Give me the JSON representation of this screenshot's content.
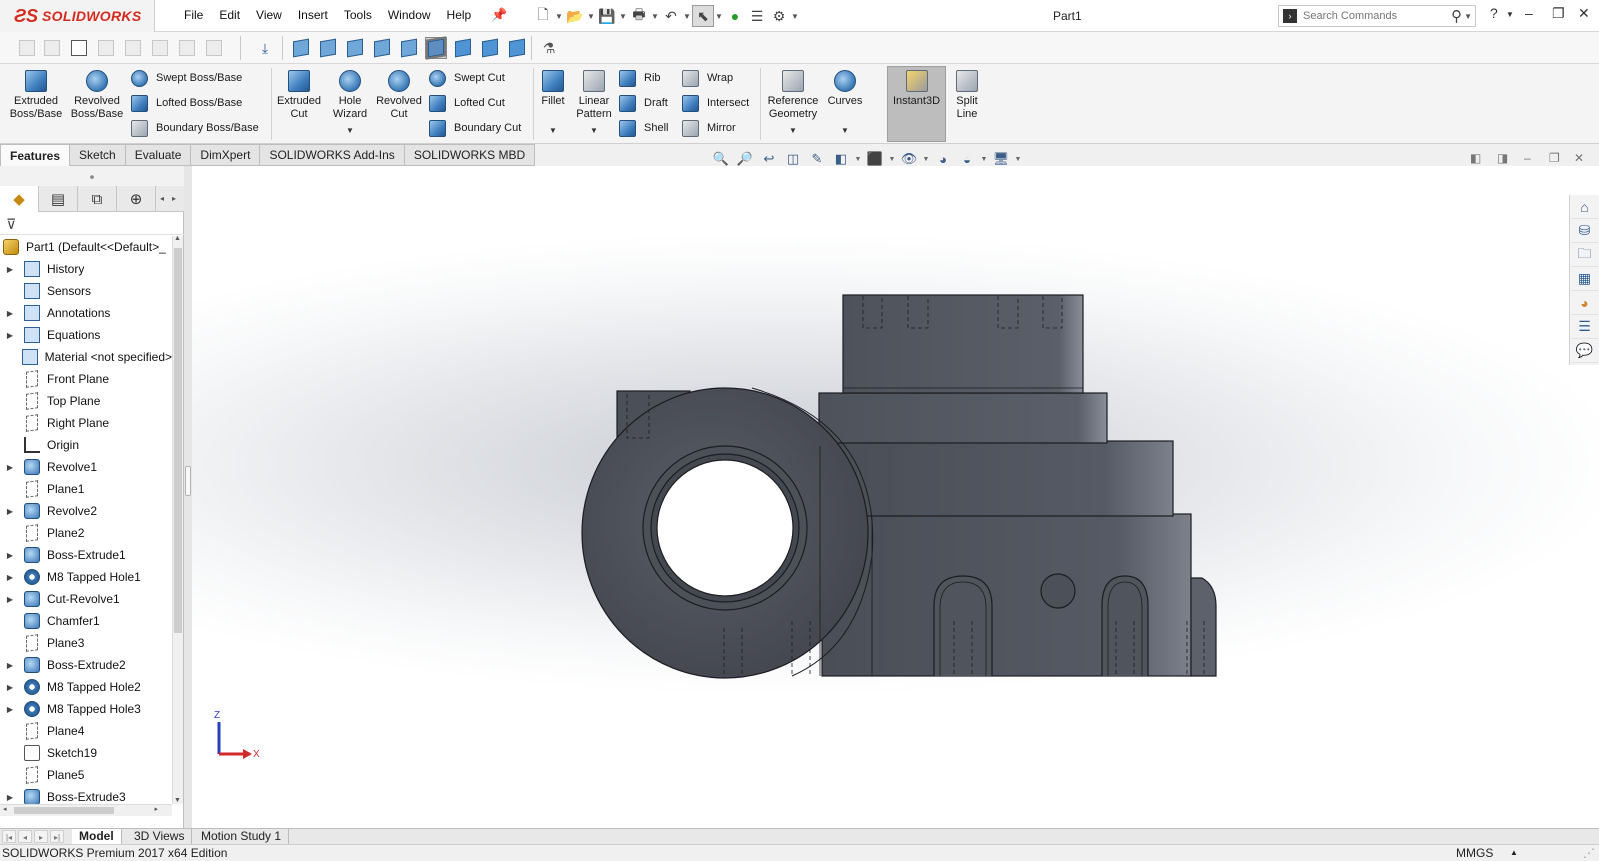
{
  "app": {
    "brand": "SOLIDWORKS",
    "document_title": "Part1"
  },
  "menu": [
    "File",
    "Edit",
    "View",
    "Insert",
    "Tools",
    "Window",
    "Help"
  ],
  "search": {
    "placeholder": "Search Commands"
  },
  "ribbon": {
    "extruded_boss": [
      "Extruded",
      "Boss/Base"
    ],
    "revolved_boss": [
      "Revolved",
      "Boss/Base"
    ],
    "swept_boss": "Swept Boss/Base",
    "lofted_boss": "Lofted Boss/Base",
    "boundary_boss": "Boundary Boss/Base",
    "extruded_cut": [
      "Extruded",
      "Cut"
    ],
    "hole_wizard": [
      "Hole",
      "Wizard"
    ],
    "revolved_cut": [
      "Revolved",
      "Cut"
    ],
    "swept_cut": "Swept Cut",
    "lofted_cut": "Lofted Cut",
    "boundary_cut": "Boundary Cut",
    "fillet": "Fillet",
    "linear_pattern": [
      "Linear",
      "Pattern"
    ],
    "rib": "Rib",
    "draft": "Draft",
    "shell": "Shell",
    "wrap": "Wrap",
    "intersect": "Intersect",
    "mirror": "Mirror",
    "reference_geometry": [
      "Reference",
      "Geometry"
    ],
    "curves": "Curves",
    "instant3d": "Instant3D",
    "split_line": [
      "Split",
      "Line"
    ]
  },
  "tabs": [
    "Features",
    "Sketch",
    "Evaluate",
    "DimXpert",
    "SOLIDWORKS Add-Ins",
    "SOLIDWORKS MBD"
  ],
  "tree": {
    "root": "Part1  (Default<<Default>_",
    "nodes": [
      {
        "label": "History",
        "icon": "history-icon",
        "expand": true
      },
      {
        "label": "Sensors",
        "icon": "sensors-icon",
        "expand": false
      },
      {
        "label": "Annotations",
        "icon": "annotations-icon",
        "expand": true
      },
      {
        "label": "Equations",
        "icon": "equations-icon",
        "expand": true
      },
      {
        "label": "Material <not specified>",
        "icon": "material-icon",
        "expand": false
      },
      {
        "label": "Front Plane",
        "icon": "plane-icon",
        "expand": false
      },
      {
        "label": "Top Plane",
        "icon": "plane-icon",
        "expand": false
      },
      {
        "label": "Right Plane",
        "icon": "plane-icon",
        "expand": false
      },
      {
        "label": "Origin",
        "icon": "origin-icon",
        "expand": false
      },
      {
        "label": "Revolve1",
        "icon": "revolve-icon",
        "expand": true
      },
      {
        "label": "Plane1",
        "icon": "plane-icon",
        "expand": false
      },
      {
        "label": "Revolve2",
        "icon": "revolve-icon",
        "expand": true
      },
      {
        "label": "Plane2",
        "icon": "plane-icon",
        "expand": false
      },
      {
        "label": "Boss-Extrude1",
        "icon": "extrude-icon",
        "expand": true
      },
      {
        "label": "M8 Tapped Hole1",
        "icon": "hole-icon",
        "expand": true
      },
      {
        "label": "Cut-Revolve1",
        "icon": "cut-revolve-icon",
        "expand": true
      },
      {
        "label": "Chamfer1",
        "icon": "chamfer-icon",
        "expand": false
      },
      {
        "label": "Plane3",
        "icon": "plane-icon",
        "expand": false
      },
      {
        "label": "Boss-Extrude2",
        "icon": "extrude-icon",
        "expand": true
      },
      {
        "label": "M8 Tapped Hole2",
        "icon": "hole-icon",
        "expand": true
      },
      {
        "label": "M8 Tapped Hole3",
        "icon": "hole-icon",
        "expand": true
      },
      {
        "label": "Plane4",
        "icon": "plane-icon",
        "expand": false
      },
      {
        "label": "Sketch19",
        "icon": "sketch-icon",
        "expand": false
      },
      {
        "label": "Plane5",
        "icon": "plane-icon",
        "expand": false
      },
      {
        "label": "Boss-Extrude3",
        "icon": "extrude-icon",
        "expand": true
      }
    ]
  },
  "triad": {
    "z_label": "Z",
    "x_label": "X"
  },
  "bottom_tabs": [
    "Model",
    "3D Views",
    "Motion Study 1"
  ],
  "status": {
    "edition": "SOLIDWORKS Premium 2017 x64 Edition",
    "units": "MMGS"
  },
  "colors": {
    "model": "#52565f",
    "model_edge": "#1c1d22",
    "accent_red": "#d52b1e"
  }
}
